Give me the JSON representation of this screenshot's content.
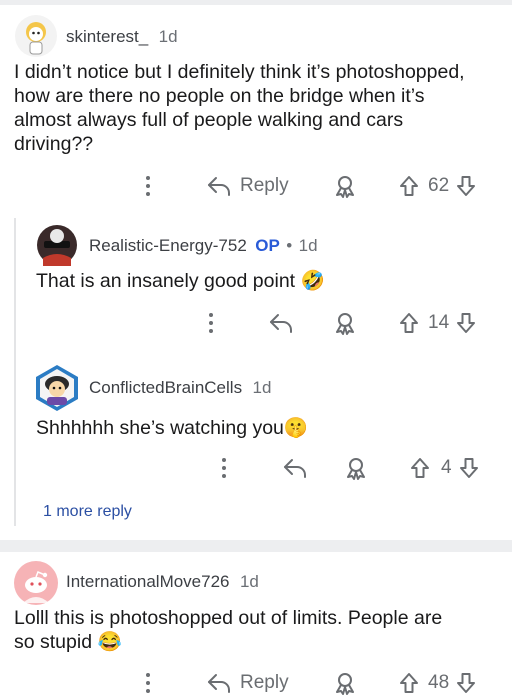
{
  "comments": [
    {
      "username": "skinterest_",
      "age": "1d",
      "body_lines": [
        "I didn’t notice but I definitely think it’s photoshopped,",
        "how are there no people on the bridge when it’s",
        "almost always full of people walking and cars",
        "driving??"
      ],
      "reply_label": "Reply",
      "votes": "62"
    },
    {
      "username": "Realistic-Energy-752",
      "op_badge": "OP",
      "separator": "•",
      "age": "1d",
      "body": "That is an insanely good point",
      "body_emoji": "🤣",
      "votes": "14"
    },
    {
      "username": "ConflictedBrainCells",
      "age": "1d",
      "body": "Shhhhhh she’s watching you",
      "body_emoji": "🤫",
      "votes": "4"
    },
    {
      "username": "InternationalMove726",
      "age": "1d",
      "body_lines": [
        "Lolll this is photoshopped out of limits. People are",
        "so stupid"
      ],
      "body_emoji": "😂",
      "reply_label": "Reply",
      "votes": "48"
    }
  ],
  "more_replies_label": "1 more reply",
  "icons": {
    "overflow": "more-options-icon",
    "reply": "reply-arrow-icon",
    "award": "award-icon",
    "upvote": "upvote-arrow-icon",
    "downvote": "downvote-arrow-icon"
  },
  "colors": {
    "separator_band": "#edeef0",
    "op_badge": "#2a5bd7",
    "more_link": "#2b4fa3",
    "avatar_pink": "#f6b3b6"
  }
}
